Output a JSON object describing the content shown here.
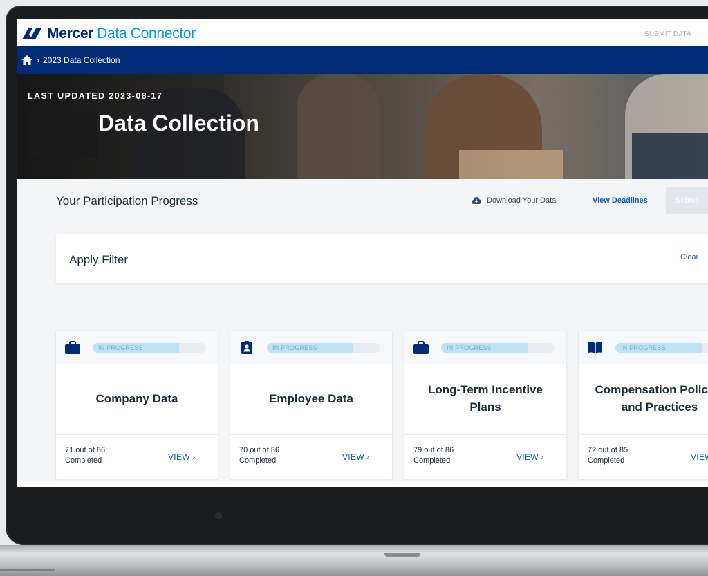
{
  "app": {
    "brand": "Mercer",
    "product": "Data Connector",
    "submit_link": "SUBMIT DATA"
  },
  "breadcrumb": {
    "current": "2023 Data Collection"
  },
  "hero": {
    "last_updated": "LAST UPDATED 2023-08-17",
    "title": "Data Collection"
  },
  "progress": {
    "title": "Your Participation Progress",
    "download_label": "Download Your Data",
    "deadlines_label": "View Deadlines",
    "submit_label": "Submit"
  },
  "filter": {
    "title": "Apply Filter",
    "clear_label": "Clear"
  },
  "cards": [
    {
      "icon": "briefcase-icon",
      "status": "IN PROGRESS",
      "progress": 0.82,
      "title": "Company Data",
      "count_line1": "71 out of 86",
      "count_line2": "Completed",
      "view": "VIEW  ›"
    },
    {
      "icon": "id-badge-icon",
      "status": "IN PROGRESS",
      "progress": 0.81,
      "title": "Employee Data",
      "count_line1": "70 out of 86",
      "count_line2": "Completed",
      "view": "VIEW  ›"
    },
    {
      "icon": "briefcase-icon",
      "status": "IN PROGRESS",
      "progress": 0.75,
      "title": "Long-Term Incentive Plans",
      "count_line1": "79 out of 86",
      "count_line2": "Completed",
      "view": "VIEW  ›"
    },
    {
      "icon": "book-icon",
      "status": "IN PROGRESS",
      "progress": 0.85,
      "title": "Compensation Policies and Practices",
      "count_line1": "72 out of 85",
      "count_line2": "Completed",
      "view": "VIEW  ›"
    }
  ],
  "colors": {
    "brand_navy": "#002c77",
    "brand_blue": "#009de0",
    "link_blue": "#0e5fb0"
  }
}
